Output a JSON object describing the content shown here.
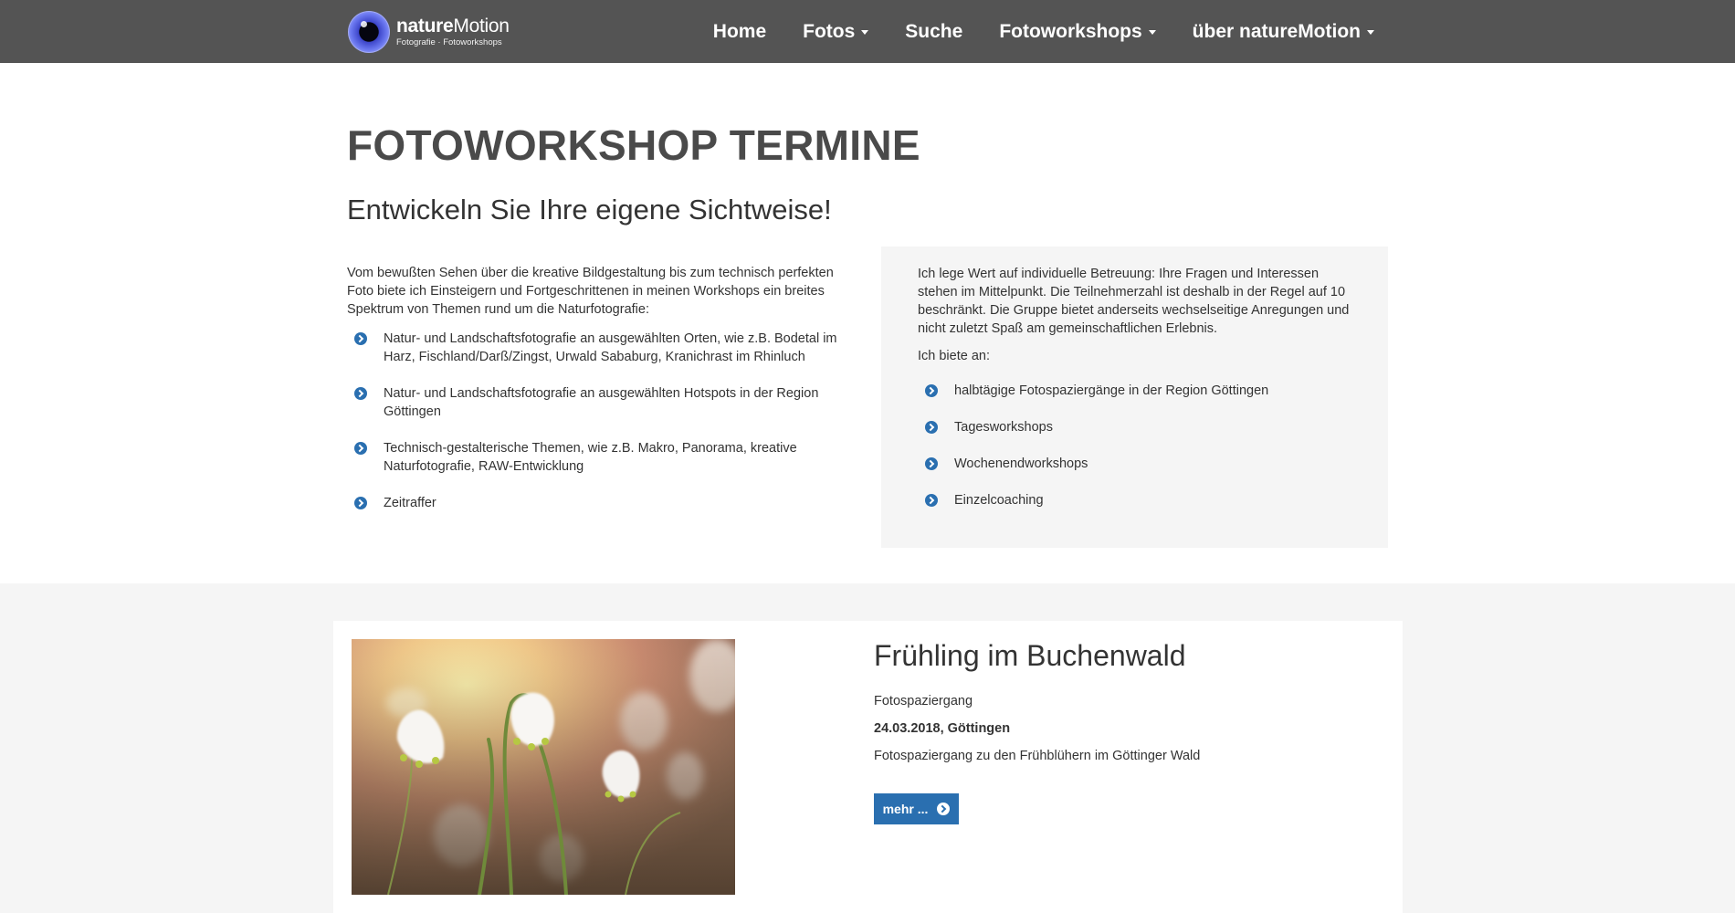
{
  "brand": {
    "name_bold": "nature",
    "name_rest": "Motion",
    "tagline": "Fotografie · Fotoworkshops",
    "logo_icon": "eye-lens-icon"
  },
  "nav": {
    "items": [
      {
        "label": "Home",
        "dropdown": false
      },
      {
        "label": "Fotos",
        "dropdown": true
      },
      {
        "label": "Suche",
        "dropdown": false
      },
      {
        "label": "Fotoworkshops",
        "dropdown": true
      },
      {
        "label": "über natureMotion",
        "dropdown": true
      }
    ]
  },
  "intro": {
    "title": "FOTOWORKSHOP TERMINE",
    "subtitle": "Entwickeln Sie Ihre eigene Sichtweise!",
    "left_text": "Vom bewußten Sehen über die kreative Bildgestaltung bis zum technisch perfekten Foto biete ich Einsteigern und Fortgeschrittenen in meinen Workshops ein breites Spektrum von Themen rund um die Naturfotografie:",
    "left_bullets": [
      "Natur- und Landschaftsfotografie an ausgewählten Orten, wie z.B. Bodetal im Harz, Fischland/Darß/Zingst, Urwald Sababurg, Kranichrast im Rhinluch",
      "Natur- und Landschaftsfotografie an ausgewählten Hotspots in der Region Göttingen",
      "Technisch-gestalterische Themen, wie z.B. Makro, Panorama, kreative Naturfotografie, RAW-Entwicklung",
      "Zeitraffer"
    ],
    "right_text": "Ich lege Wert auf individuelle Betreuung: Ihre Fragen und Interessen stehen im Mittelpunkt. Die Teilnehmerzahl ist deshalb in der Regel auf 10 beschränkt. Die Gruppe bietet anderseits wechselseitige Anregungen und nicht zuletzt Spaß am gemeinschaftlichen Erlebnis.",
    "right_lead": "Ich biete an:",
    "right_bullets": [
      "halbtägige Fotospaziergänge in der Region Göttingen",
      "Tagesworkshops",
      "Wochenendworkshops",
      "Einzelcoaching"
    ]
  },
  "event": {
    "title": "Frühling im Buchenwald",
    "type": "Fotospaziergang",
    "date_place": "24.03.2018, Göttingen",
    "description": "Fotospaziergang zu den Frühblühern im Göttinger Wald",
    "button_label": "mehr ...",
    "button_icon": "chevron-circle-right-icon"
  },
  "colors": {
    "navbar": "#545454",
    "accent": "#2a6fb0",
    "panel": "#f5f5f5"
  }
}
